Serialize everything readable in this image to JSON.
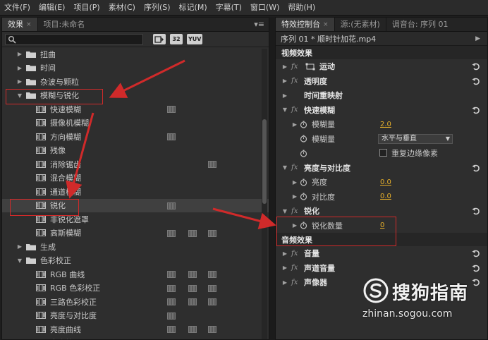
{
  "menubar": {
    "items": [
      "文件(F)",
      "编辑(E)",
      "项目(P)",
      "素材(C)",
      "序列(S)",
      "标记(M)",
      "字幕(T)",
      "窗口(W)",
      "帮助(H)"
    ]
  },
  "left_panel": {
    "tabs": [
      {
        "label": "效果",
        "close": "×"
      },
      {
        "label": "项目:未命名"
      }
    ],
    "panel_menu": "▾≡",
    "search": {
      "value": "",
      "placeholder": ""
    },
    "toolbar_buttons": [
      "32",
      "YUV"
    ],
    "tree": [
      {
        "label": "扭曲",
        "type": "folder",
        "depth": 1,
        "expanded": false
      },
      {
        "label": "时间",
        "type": "folder",
        "depth": 1,
        "expanded": false
      },
      {
        "label": "杂波与颗粒",
        "type": "folder",
        "depth": 1,
        "expanded": false
      },
      {
        "label": "模糊与锐化",
        "type": "folder",
        "depth": 1,
        "expanded": true
      },
      {
        "label": "快速模糊",
        "type": "effect",
        "depth": 2,
        "badges": [
          1
        ]
      },
      {
        "label": "摄像机模糊",
        "type": "effect",
        "depth": 2,
        "badges": []
      },
      {
        "label": "方向模糊",
        "type": "effect",
        "depth": 2,
        "badges": [
          1
        ]
      },
      {
        "label": "残像",
        "type": "effect",
        "depth": 2,
        "badges": []
      },
      {
        "label": "消除锯齿",
        "type": "effect",
        "depth": 2,
        "badges": [
          3
        ]
      },
      {
        "label": "混合模糊",
        "type": "effect",
        "depth": 2,
        "badges": []
      },
      {
        "label": "通道模糊",
        "type": "effect",
        "depth": 2,
        "badges": []
      },
      {
        "label": "锐化",
        "type": "effect",
        "depth": 2,
        "badges": [
          1
        ],
        "selected": true
      },
      {
        "label": "非锐化遮罩",
        "type": "effect",
        "depth": 2,
        "badges": []
      },
      {
        "label": "高斯模糊",
        "type": "effect",
        "depth": 2,
        "badges": [
          1,
          2,
          3
        ]
      },
      {
        "label": "生成",
        "type": "folder",
        "depth": 1,
        "expanded": false
      },
      {
        "label": "色彩校正",
        "type": "folder",
        "depth": 1,
        "expanded": true
      },
      {
        "label": "RGB 曲线",
        "type": "effect",
        "depth": 2,
        "badges": [
          1,
          2,
          3
        ]
      },
      {
        "label": "RGB 色彩校正",
        "type": "effect",
        "depth": 2,
        "badges": [
          1,
          2,
          3
        ]
      },
      {
        "label": "三路色彩校正",
        "type": "effect",
        "depth": 2,
        "badges": [
          1,
          2,
          3
        ]
      },
      {
        "label": "亮度与对比度",
        "type": "effect",
        "depth": 2,
        "badges": [
          1
        ]
      },
      {
        "label": "亮度曲线",
        "type": "effect",
        "depth": 2,
        "badges": [
          1,
          2,
          3
        ]
      },
      {
        "label": "亮度校正",
        "type": "effect",
        "depth": 2,
        "badges": [
          1,
          2,
          3
        ]
      }
    ]
  },
  "right_panel": {
    "tabs": [
      {
        "label": "特效控制台",
        "close": "×"
      },
      {
        "label": "源:(无素材)"
      },
      {
        "label": "调音台: 序列 01"
      }
    ],
    "sequence_clip": "序列 01 * 顺时针加花.mp4",
    "video_section": "视频效果",
    "audio_section": "音频效果",
    "rows": [
      {
        "kind": "effect",
        "name": "运动",
        "expanded": false,
        "motion_icon": true,
        "reset": true
      },
      {
        "kind": "effect",
        "name": "透明度",
        "expanded": false,
        "reset": true
      },
      {
        "kind": "effect",
        "name": "时间重映射",
        "expanded": false,
        "no_fx": true
      },
      {
        "kind": "effect",
        "name": "快速模糊",
        "expanded": true,
        "reset": true
      },
      {
        "kind": "prop",
        "name": "模糊量",
        "value": "2.0",
        "expandable": true
      },
      {
        "kind": "prop",
        "name": "模糊量",
        "dropdown": "水平与垂直"
      },
      {
        "kind": "prop",
        "name": "",
        "checkbox_label": "重复边缘像素"
      },
      {
        "kind": "effect",
        "name": "亮度与对比度",
        "expanded": true,
        "reset": true
      },
      {
        "kind": "prop",
        "name": "亮度",
        "value": "0.0",
        "expandable": true
      },
      {
        "kind": "prop",
        "name": "对比度",
        "value": "0.0",
        "expandable": true
      },
      {
        "kind": "effect",
        "name": "锐化",
        "expanded": true,
        "reset": true
      },
      {
        "kind": "prop",
        "name": "锐化数量",
        "value": "0",
        "expandable": true
      }
    ],
    "audio_rows": [
      {
        "kind": "effect",
        "name": "音量",
        "reset": true
      },
      {
        "kind": "effect",
        "name": "声道音量",
        "reset": true
      },
      {
        "kind": "effect",
        "name": "声像器",
        "reset": true
      }
    ]
  },
  "watermark": {
    "title": "搜狗指南",
    "url": "zhinan.sogou.com"
  },
  "annotation_color": "#d02a2a"
}
